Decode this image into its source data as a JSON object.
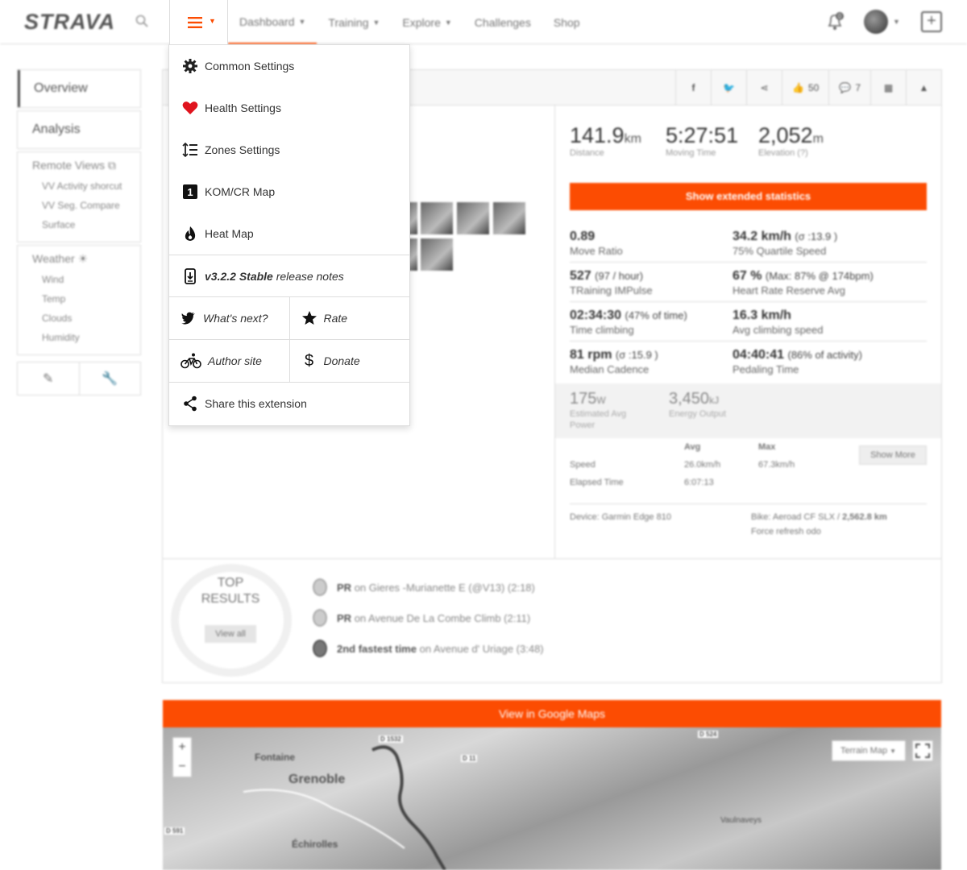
{
  "topbar": {
    "logo": "STRAVA",
    "nav": [
      {
        "label": "Dashboard",
        "has_caret": true,
        "active": true
      },
      {
        "label": "Training",
        "has_caret": true
      },
      {
        "label": "Explore",
        "has_caret": true
      },
      {
        "label": "Challenges",
        "has_caret": false
      },
      {
        "label": "Shop",
        "has_caret": false
      }
    ],
    "notification_count": "0",
    "brand_color": "#fc4c02"
  },
  "menu": {
    "items": [
      {
        "label": "Common Settings",
        "icon": "gear-icon"
      },
      {
        "label": "Health Settings",
        "icon": "heart-icon"
      },
      {
        "label": "Zones Settings",
        "icon": "zones-icon"
      },
      {
        "label": "KOM/CR Map",
        "icon": "kom-icon"
      },
      {
        "label": "Heat Map",
        "icon": "flame-icon"
      }
    ],
    "release": {
      "version": "v3.2.2 Stable",
      "suffix": "release notes"
    },
    "whats_next": "What's next?",
    "rate": "Rate",
    "author_site": "Author site",
    "donate": "Donate",
    "share": "Share this extension"
  },
  "sidenav": {
    "overview": "Overview",
    "analysis": "Analysis",
    "remote_views": "Remote Views",
    "remote_items": [
      "VV Activity shorcut",
      "VV Seg. Compare",
      "Surface"
    ],
    "weather": "Weather",
    "weather_items": [
      "Wind",
      "Temp",
      "Clouds",
      "Humidity"
    ]
  },
  "share_bar": {
    "kudos": "50",
    "comments": "7"
  },
  "stats": {
    "distance": {
      "value": "141.9",
      "unit": "km",
      "label": "Distance"
    },
    "moving_time": {
      "value": "5:27:51",
      "label": "Moving Time"
    },
    "elevation": {
      "value": "2,052",
      "unit": "m",
      "label": "Elevation (?)"
    },
    "extended_button": "Show extended statistics",
    "rows": [
      [
        {
          "value": "0.89",
          "sub": "",
          "label": "Move Ratio"
        },
        {
          "value": "34.2 km/h",
          "sub": "(σ :13.9 )",
          "label": "75% Quartile Speed"
        }
      ],
      [
        {
          "value": "527",
          "sub": "(97 / hour)",
          "label": "TRaining IMPulse"
        },
        {
          "value": "67 %",
          "sub": "(Max: 87% @ 174bpm)",
          "label": "Heart Rate Reserve Avg"
        }
      ],
      [
        {
          "value": "02:34:30",
          "sub": "(47% of time)",
          "label": "Time climbing"
        },
        {
          "value": "16.3 km/h",
          "sub": "",
          "label": "Avg climbing speed"
        }
      ],
      [
        {
          "value": "81 rpm",
          "sub": "(σ :15.9 )",
          "label": "Median Cadence"
        },
        {
          "value": "04:40:41",
          "sub": "(86% of activity)",
          "label": "Pedaling Time"
        }
      ]
    ],
    "power": {
      "value": "175",
      "unit": "W",
      "label": "Estimated Avg Power"
    },
    "energy": {
      "value": "3,450",
      "unit": "kJ",
      "label": "Energy Output"
    },
    "table": {
      "headers": [
        "Avg",
        "Max"
      ],
      "rows": [
        {
          "label": "Speed",
          "avg": "26.0km/h",
          "max": "67.3km/h"
        },
        {
          "label": "Elapsed Time",
          "avg": "6:07:13",
          "max": ""
        }
      ],
      "show_more": "Show More"
    },
    "device": "Device: Garmin Edge 810",
    "bike": "Bike: Aeroad CF SLX / ",
    "bike_km": "2,562.8 km",
    "force_refresh": "Force refresh odo"
  },
  "top_results": {
    "title": "TOP RESULTS",
    "view_all": "View all",
    "items": [
      {
        "bold": "PR",
        "text": "on Gieres -Murianette E (@V13) (2:18)"
      },
      {
        "bold": "PR",
        "text": "on Avenue De La Combe Climb (2:11)"
      },
      {
        "bold": "2nd fastest time",
        "text": "on Avenue d' Uriage (3:48)"
      }
    ]
  },
  "map": {
    "google_button": "View in Google Maps",
    "terrain": "Terrain Map",
    "labels": [
      "Fontaine",
      "Grenoble",
      "Échirolles",
      "Vaulnaveys"
    ],
    "roads": [
      "D 1532",
      "D 11",
      "D 524",
      "D 591"
    ]
  }
}
